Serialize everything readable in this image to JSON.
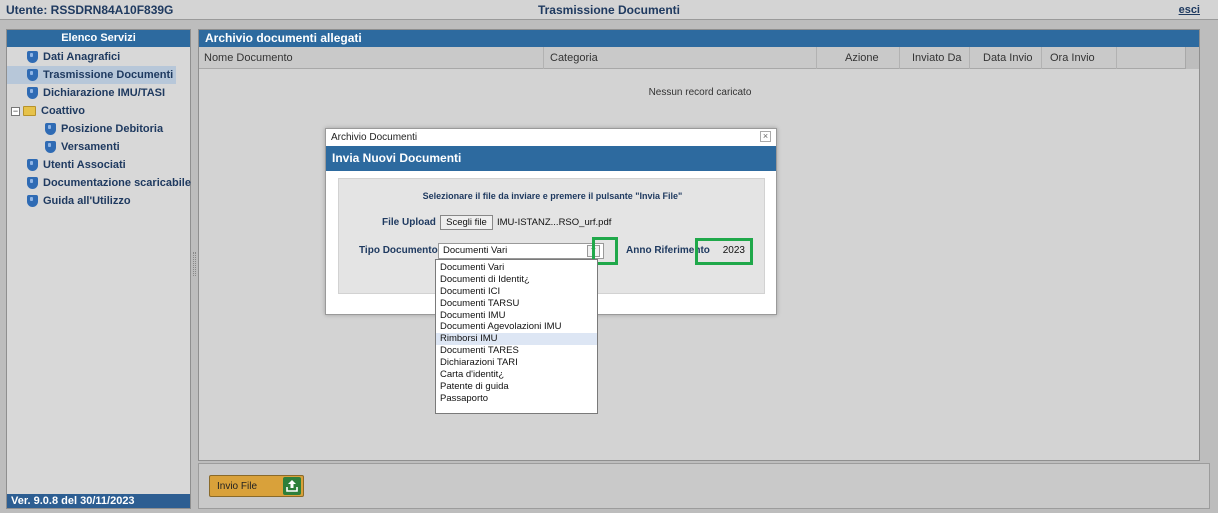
{
  "header": {
    "user": "Utente: RSSDRN84A10F839G",
    "title": "Trasmissione Documenti",
    "logout": "esci"
  },
  "sidebar": {
    "title": "Elenco Servizi",
    "items": [
      {
        "label": "Dati Anagrafici",
        "icon": "shield-icon"
      },
      {
        "label": "Trasmissione Documenti",
        "icon": "shield-icon",
        "active": true
      },
      {
        "label": "Dichiarazione IMU/TASI",
        "icon": "shield-icon"
      },
      {
        "label": "Coattivo",
        "icon": "folder-icon",
        "expander": "−"
      },
      {
        "label": "Posizione Debitoria",
        "icon": "shield-icon"
      },
      {
        "label": "Versamenti",
        "icon": "shield-icon"
      },
      {
        "label": "Utenti Associati",
        "icon": "shield-icon"
      },
      {
        "label": "Documentazione scaricabile",
        "icon": "shield-icon"
      },
      {
        "label": "Guida all'Utilizzo",
        "icon": "shield-icon"
      }
    ],
    "version": "Ver. 9.0.8 del 30/11/2023"
  },
  "main": {
    "title": "Archivio documenti allegati",
    "columns": [
      "Nome Documento",
      "Categoria",
      "Azione",
      "Inviato Da",
      "Data Invio",
      "Ora Invio"
    ],
    "empty_message": "Nessun record caricato"
  },
  "footer": {
    "send_button": "Invio File",
    "send_icon": "upload-icon"
  },
  "dialog": {
    "window_title": "Archivio Documenti",
    "close": "×",
    "header": "Invia Nuovi Documenti",
    "instruction": "Selezionare il file da inviare e premere il pulsante \"Invia File\"",
    "file_upload_label": "File Upload",
    "choose_file_button": "Scegli file",
    "file_name": "IMU-ISTANZ...RSO_urf.pdf",
    "tipo_documento_label": "Tipo Documento",
    "tipo_documento_value": "Documenti Vari",
    "anno_label": "Anno Riferimento",
    "anno_value": "2023",
    "highlight_color": "#1fa84a",
    "options": [
      "Documenti Vari",
      "Documenti di Identit¿",
      "Documenti ICI",
      "Documenti TARSU",
      "Documenti IMU",
      "Documenti Agevolazioni IMU",
      "Rimborsi IMU",
      "Documenti TARES",
      "Dichiarazioni TARI",
      "Carta d'identit¿",
      "Patente di guida",
      "Passaporto"
    ],
    "hovered_option": "Rimborsi IMU"
  },
  "colors": {
    "panel_header": "#2d6a9f",
    "button_orange": "#d9a13a",
    "button_icon_green": "#2e7f3a",
    "menu_text": "#1f3a60"
  }
}
